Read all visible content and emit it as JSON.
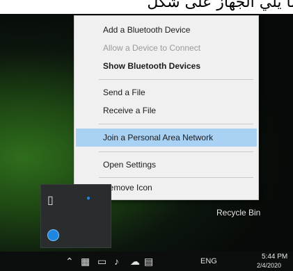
{
  "overlay_text": "ما يلي الجهاز على شكل",
  "context_menu": {
    "items": [
      {
        "label": "Add a Bluetooth Device",
        "state": "normal"
      },
      {
        "label": "Allow a Device to Connect",
        "state": "disabled"
      },
      {
        "label": "Show Bluetooth Devices",
        "state": "bold"
      },
      {
        "label": "Send a File",
        "state": "normal"
      },
      {
        "label": "Receive a File",
        "state": "normal"
      },
      {
        "label": "Join a Personal Area Network",
        "state": "highlighted"
      },
      {
        "label": "Open Settings",
        "state": "normal"
      },
      {
        "label": "Remove Icon",
        "state": "normal"
      }
    ]
  },
  "desktop": {
    "recycle_bin_label": "Recycle Bin"
  },
  "tray_flyout": {
    "icons": [
      "usb-device-icon",
      "bluetooth-icon"
    ]
  },
  "taskbar": {
    "icons": [
      "chevron-up-icon",
      "network-icon",
      "monitor-icon",
      "volume-icon",
      "onedrive-icon",
      "keyboard-icon"
    ],
    "language": "ENG",
    "time": "5:44 PM",
    "date": "2/4/2020"
  },
  "colors": {
    "menu_bg": "#f0f0f0",
    "highlight": "#a9d1f3",
    "taskbar_bg": "#0c0e0e"
  }
}
